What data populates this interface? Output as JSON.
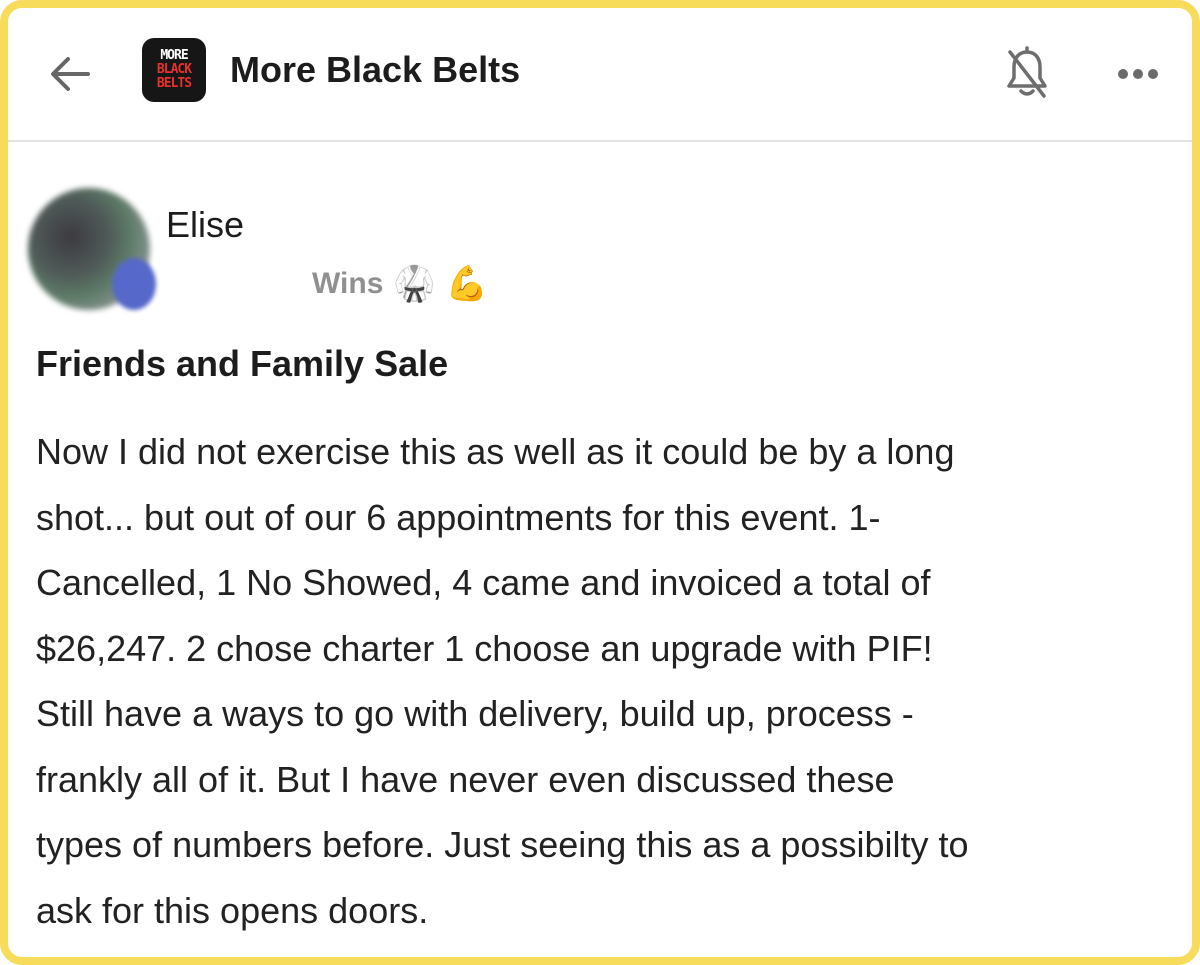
{
  "header": {
    "back_icon": "back-arrow-icon",
    "logo_lines": [
      "MORE",
      "BLACK",
      "BELTS"
    ],
    "logo_colors": {
      "top": "#ffffff",
      "bottom": "#e8322b",
      "background": "#161616"
    },
    "group_title": "More Black Belts",
    "bell_icon": "bell-off-icon",
    "more_icon": "more-dots-icon"
  },
  "post": {
    "author": "Elise",
    "category": "Wins",
    "category_emojis": [
      "🥋",
      "💪"
    ],
    "title": "Friends and Family Sale",
    "body_lines": [
      "Now I did not exercise this as well as it could be by a long",
      "shot... but out of our 6 appointments for this event. 1-",
      "Cancelled, 1 No Showed, 4 came and invoiced a total of",
      "$26,247. 2 chose charter 1 choose an upgrade with PIF!",
      "Still have a ways to go with delivery, build up, process -",
      "frankly all of it. But I have never even discussed these",
      "types of numbers before. Just seeing this as a possibilty to",
      "ask for this opens doors."
    ]
  },
  "theme": {
    "frame_border": "#f7dc5c",
    "text": "#1c1c1c",
    "muted": "#909090"
  }
}
